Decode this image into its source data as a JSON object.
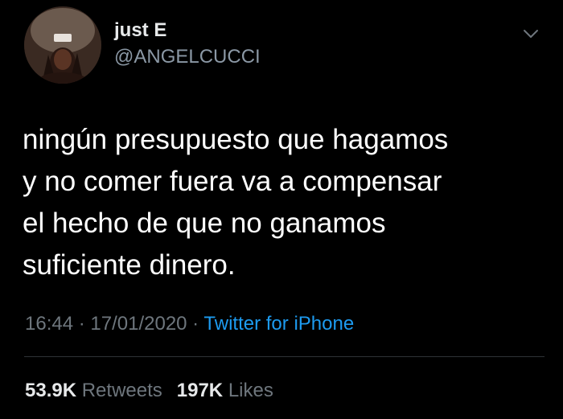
{
  "tweet": {
    "author": {
      "display_name": "just E",
      "handle": "@ANGELCUCCI",
      "avatar": "profile-photo"
    },
    "menu_icon": "chevron-down-icon",
    "text": "ningún presupuesto que hagamos\ny no comer fuera va a compensar\nel hecho de que no ganamos\nsuficiente dinero.",
    "time": "16:44",
    "separator": " · ",
    "date": "17/01/2020",
    "source": "Twitter for iPhone",
    "stats": {
      "retweets_count": "53.9K",
      "retweets_label": "Retweets",
      "likes_count": "197K",
      "likes_label": "Likes"
    }
  },
  "colors": {
    "background": "#000000",
    "primary_text": "#ffffff",
    "secondary_text": "#6e767d",
    "link": "#1d9bf0",
    "divider": "#2f3336"
  }
}
